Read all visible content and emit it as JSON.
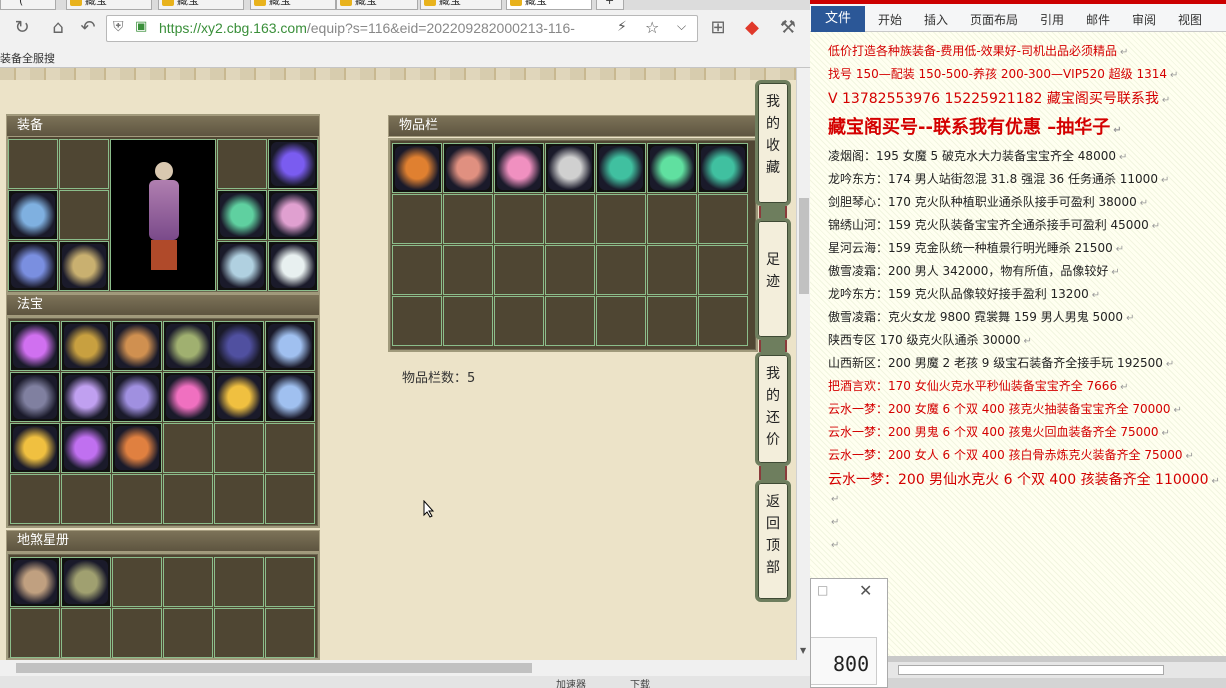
{
  "browser": {
    "tabs": [
      "(",
      "藏宝",
      "藏宝",
      "藏宝",
      "藏宝",
      "藏宝",
      "藏宝"
    ],
    "url_host": "https://xy2.cbg.163.com",
    "url_path": "/equip?s=116&eid=202209282000213-116-",
    "bookmark": "装备全服搜",
    "status_items": [
      "加速器",
      "下载"
    ]
  },
  "game": {
    "equip_title": "装备",
    "fabao_title": "法宝",
    "disha_title": "地煞星册",
    "inventory_title": "物品栏",
    "inventory_count_label": "物品栏数：5",
    "side_buttons": [
      {
        "label": [
          "我",
          "的",
          "收",
          "藏"
        ]
      },
      {
        "label": [
          "足",
          "迹"
        ]
      },
      {
        "label": [
          "我",
          "的",
          "还",
          "价"
        ]
      },
      {
        "label": [
          "返",
          "回",
          "顶",
          "部"
        ]
      }
    ]
  },
  "word": {
    "file_tab": "文件",
    "tabs": [
      "开始",
      "插入",
      "页面布局",
      "引用",
      "邮件",
      "审阅",
      "视图"
    ],
    "lines": [
      {
        "text": "低价打造各种族装备-费用低-效果好-司机出品必须精品",
        "cls": "red",
        "size": 12
      },
      {
        "text": "找号 150—配装 150-500-养孩 200-300—VIP520 超级 1314",
        "cls": "red",
        "size": 12
      },
      {
        "text": "V 13782553976    15225921182  藏宝阁买号联系我",
        "cls": "red",
        "size": 14
      },
      {
        "text": "藏宝阁买号--联系我有优惠 –抽华子",
        "cls": "red",
        "size": 18
      },
      {
        "text": "凌烟阁：195 女魔 5 破克水大力装备宝宝齐全 48000",
        "cls": "",
        "size": 12
      },
      {
        "text": "龙吟东方：174 男人站街忽混 31.8 强混 36 任务通杀 11000",
        "cls": "",
        "size": 12
      },
      {
        "text": "剑胆琴心：170 克火队种植职业通杀队接手可盈利 38000",
        "cls": "",
        "size": 12
      },
      {
        "text": "锦绣山河：159 克火队装备宝宝齐全通杀接手可盈利 45000",
        "cls": "",
        "size": 12
      },
      {
        "text": "星河云海：159 克金队统一种植景行明光睡杀 21500",
        "cls": "",
        "size": 12
      },
      {
        "text": "傲雪凌霜：200 男人 342000，物有所值，品像较好",
        "cls": "",
        "size": 12
      },
      {
        "text": "龙吟东方：159 克火队品像较好接手盈利 13200",
        "cls": "",
        "size": 12
      },
      {
        "text": "傲雪凌霜：克火女龙 9800      霓裳舞 159 男人男鬼 5000",
        "cls": "",
        "size": 12
      },
      {
        "text": "陕西专区 170 级克火队通杀 30000",
        "cls": "",
        "size": 12
      },
      {
        "text": "山西新区：200 男魔 2 老孩 9 级宝石装备齐全接手玩 192500",
        "cls": "",
        "size": 12
      },
      {
        "text": "把酒言欢：170 女仙火克水平秒仙装备宝宝齐全 7666",
        "cls": "red",
        "size": 12
      },
      {
        "text": "云水一梦：200 女魔 6 个双 400 孩克火抽装备宝宝齐全 70000",
        "cls": "red",
        "size": 12
      },
      {
        "text": "云水一梦：200 男鬼 6 个双 400 孩鬼火回血装备齐全 75000",
        "cls": "red",
        "size": 12
      },
      {
        "text": "云水一梦：200 女人 6 个双 400 孩白骨赤炼克火装备齐全 75000",
        "cls": "red",
        "size": 12
      },
      {
        "text": "云水一梦：200 男仙水克火 6 个双 400 孩装备齐全 110000",
        "cls": "red",
        "size": 14
      }
    ],
    "dialog_value": "800"
  },
  "colors": {
    "accent_red": "#d40000",
    "word_blue": "#2b5797",
    "grid_line": "#8bbd8b"
  }
}
